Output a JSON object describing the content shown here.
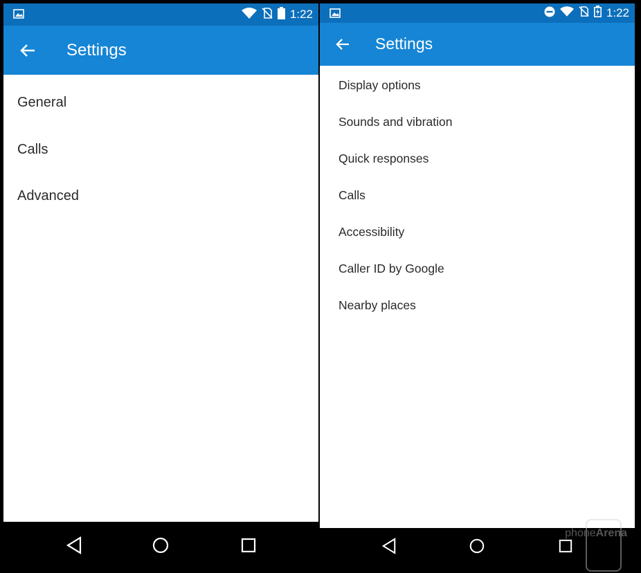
{
  "left": {
    "status": {
      "time": "1:22"
    },
    "appbar": {
      "title": "Settings"
    },
    "items": [
      "General",
      "Calls",
      "Advanced"
    ]
  },
  "right": {
    "status": {
      "time": "1:22"
    },
    "appbar": {
      "title": "Settings"
    },
    "items": [
      "Display options",
      "Sounds and vibration",
      "Quick responses",
      "Calls",
      "Accessibility",
      "Caller ID by Google",
      "Nearby places"
    ]
  },
  "watermark": {
    "brand_light": "phone",
    "brand_bold": "Arena"
  },
  "colors": {
    "status_bar": "#0c6fbb",
    "app_bar": "#1685d5",
    "background": "#ffffff",
    "nav_bar": "#000000",
    "text": "#2a2a2a"
  },
  "icons": [
    "image-notification-icon",
    "wifi-icon",
    "no-sim-icon",
    "battery-icon",
    "battery-charging-icon",
    "do-not-disturb-icon",
    "back-arrow-icon",
    "nav-back-icon",
    "nav-home-icon",
    "nav-recents-icon"
  ]
}
